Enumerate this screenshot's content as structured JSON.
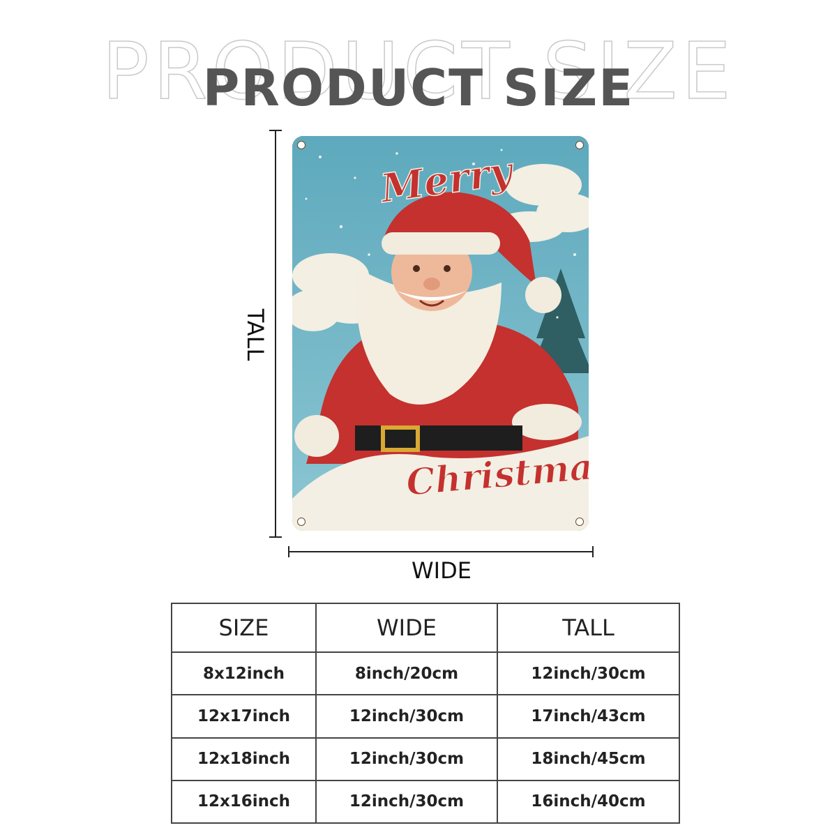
{
  "header": {
    "title_outline": "PRODUCT SIZE",
    "title": "PRODUCT SIZE"
  },
  "diagram": {
    "tall_label": "TALL",
    "wide_label": "WIDE"
  },
  "sign": {
    "text_top": "Merry",
    "text_bottom": "Christmas"
  },
  "colors": {
    "title_gray": "#555555",
    "sky_blue": "#6fb3c4",
    "santa_red": "#c4312e",
    "rust_border": "#6b4a24"
  },
  "table": {
    "headers": [
      "SIZE",
      "WIDE",
      "TALL"
    ],
    "rows": [
      [
        "8x12inch",
        "8inch/20cm",
        "12inch/30cm"
      ],
      [
        "12x17inch",
        "12inch/30cm",
        "17inch/43cm"
      ],
      [
        "12x18inch",
        "12inch/30cm",
        "18inch/45cm"
      ],
      [
        "12x16inch",
        "12inch/30cm",
        "16inch/40cm"
      ]
    ]
  }
}
